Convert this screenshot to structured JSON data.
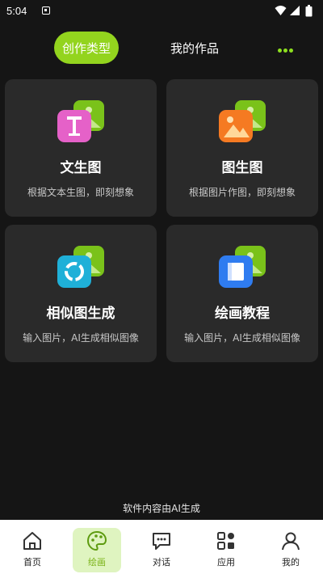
{
  "status": {
    "time": "5:04"
  },
  "header": {
    "tab_create": "创作类型",
    "tab_works": "我的作品"
  },
  "cards": [
    {
      "title": "文生图",
      "subtitle": "根据文本生图，即刻想象",
      "icon": "text-to-image-icon"
    },
    {
      "title": "图生图",
      "subtitle": "根据图片作图，即刻想象",
      "icon": "image-to-image-icon"
    },
    {
      "title": "相似图生成",
      "subtitle": "输入图片，AI生成相似图像",
      "icon": "similar-image-icon"
    },
    {
      "title": "绘画教程",
      "subtitle": "输入图片，AI生成相似图像",
      "icon": "tutorial-book-icon"
    }
  ],
  "footer_note": "软件内容由AI生成",
  "nav": [
    {
      "label": "首页",
      "icon": "home-icon"
    },
    {
      "label": "绘画",
      "icon": "palette-icon"
    },
    {
      "label": "对话",
      "icon": "chat-icon"
    },
    {
      "label": "应用",
      "icon": "apps-icon"
    },
    {
      "label": "我的",
      "icon": "profile-icon"
    }
  ],
  "colors": {
    "accent": "#93d41e",
    "background": "#151515",
    "card": "#2a2a2a"
  }
}
